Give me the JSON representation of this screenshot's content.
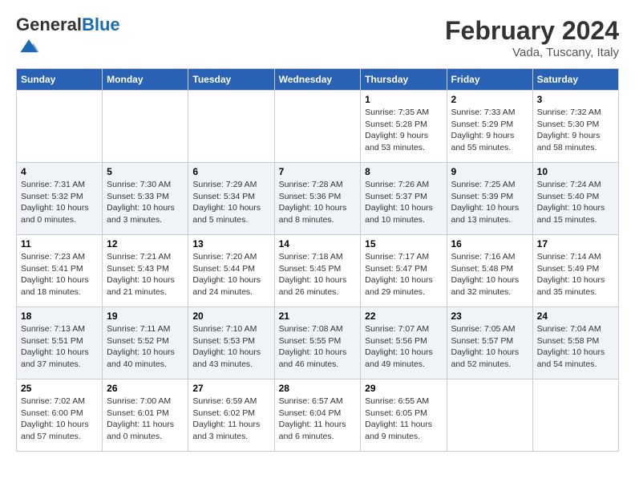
{
  "header": {
    "logo_general": "General",
    "logo_blue": "Blue",
    "month_year": "February 2024",
    "location": "Vada, Tuscany, Italy"
  },
  "days_of_week": [
    "Sunday",
    "Monday",
    "Tuesday",
    "Wednesday",
    "Thursday",
    "Friday",
    "Saturday"
  ],
  "weeks": [
    [
      {
        "day": "",
        "info": ""
      },
      {
        "day": "",
        "info": ""
      },
      {
        "day": "",
        "info": ""
      },
      {
        "day": "",
        "info": ""
      },
      {
        "day": "1",
        "info": "Sunrise: 7:35 AM\nSunset: 5:28 PM\nDaylight: 9 hours\nand 53 minutes."
      },
      {
        "day": "2",
        "info": "Sunrise: 7:33 AM\nSunset: 5:29 PM\nDaylight: 9 hours\nand 55 minutes."
      },
      {
        "day": "3",
        "info": "Sunrise: 7:32 AM\nSunset: 5:30 PM\nDaylight: 9 hours\nand 58 minutes."
      }
    ],
    [
      {
        "day": "4",
        "info": "Sunrise: 7:31 AM\nSunset: 5:32 PM\nDaylight: 10 hours\nand 0 minutes."
      },
      {
        "day": "5",
        "info": "Sunrise: 7:30 AM\nSunset: 5:33 PM\nDaylight: 10 hours\nand 3 minutes."
      },
      {
        "day": "6",
        "info": "Sunrise: 7:29 AM\nSunset: 5:34 PM\nDaylight: 10 hours\nand 5 minutes."
      },
      {
        "day": "7",
        "info": "Sunrise: 7:28 AM\nSunset: 5:36 PM\nDaylight: 10 hours\nand 8 minutes."
      },
      {
        "day": "8",
        "info": "Sunrise: 7:26 AM\nSunset: 5:37 PM\nDaylight: 10 hours\nand 10 minutes."
      },
      {
        "day": "9",
        "info": "Sunrise: 7:25 AM\nSunset: 5:39 PM\nDaylight: 10 hours\nand 13 minutes."
      },
      {
        "day": "10",
        "info": "Sunrise: 7:24 AM\nSunset: 5:40 PM\nDaylight: 10 hours\nand 15 minutes."
      }
    ],
    [
      {
        "day": "11",
        "info": "Sunrise: 7:23 AM\nSunset: 5:41 PM\nDaylight: 10 hours\nand 18 minutes."
      },
      {
        "day": "12",
        "info": "Sunrise: 7:21 AM\nSunset: 5:43 PM\nDaylight: 10 hours\nand 21 minutes."
      },
      {
        "day": "13",
        "info": "Sunrise: 7:20 AM\nSunset: 5:44 PM\nDaylight: 10 hours\nand 24 minutes."
      },
      {
        "day": "14",
        "info": "Sunrise: 7:18 AM\nSunset: 5:45 PM\nDaylight: 10 hours\nand 26 minutes."
      },
      {
        "day": "15",
        "info": "Sunrise: 7:17 AM\nSunset: 5:47 PM\nDaylight: 10 hours\nand 29 minutes."
      },
      {
        "day": "16",
        "info": "Sunrise: 7:16 AM\nSunset: 5:48 PM\nDaylight: 10 hours\nand 32 minutes."
      },
      {
        "day": "17",
        "info": "Sunrise: 7:14 AM\nSunset: 5:49 PM\nDaylight: 10 hours\nand 35 minutes."
      }
    ],
    [
      {
        "day": "18",
        "info": "Sunrise: 7:13 AM\nSunset: 5:51 PM\nDaylight: 10 hours\nand 37 minutes."
      },
      {
        "day": "19",
        "info": "Sunrise: 7:11 AM\nSunset: 5:52 PM\nDaylight: 10 hours\nand 40 minutes."
      },
      {
        "day": "20",
        "info": "Sunrise: 7:10 AM\nSunset: 5:53 PM\nDaylight: 10 hours\nand 43 minutes."
      },
      {
        "day": "21",
        "info": "Sunrise: 7:08 AM\nSunset: 5:55 PM\nDaylight: 10 hours\nand 46 minutes."
      },
      {
        "day": "22",
        "info": "Sunrise: 7:07 AM\nSunset: 5:56 PM\nDaylight: 10 hours\nand 49 minutes."
      },
      {
        "day": "23",
        "info": "Sunrise: 7:05 AM\nSunset: 5:57 PM\nDaylight: 10 hours\nand 52 minutes."
      },
      {
        "day": "24",
        "info": "Sunrise: 7:04 AM\nSunset: 5:58 PM\nDaylight: 10 hours\nand 54 minutes."
      }
    ],
    [
      {
        "day": "25",
        "info": "Sunrise: 7:02 AM\nSunset: 6:00 PM\nDaylight: 10 hours\nand 57 minutes."
      },
      {
        "day": "26",
        "info": "Sunrise: 7:00 AM\nSunset: 6:01 PM\nDaylight: 11 hours\nand 0 minutes."
      },
      {
        "day": "27",
        "info": "Sunrise: 6:59 AM\nSunset: 6:02 PM\nDaylight: 11 hours\nand 3 minutes."
      },
      {
        "day": "28",
        "info": "Sunrise: 6:57 AM\nSunset: 6:04 PM\nDaylight: 11 hours\nand 6 minutes."
      },
      {
        "day": "29",
        "info": "Sunrise: 6:55 AM\nSunset: 6:05 PM\nDaylight: 11 hours\nand 9 minutes."
      },
      {
        "day": "",
        "info": ""
      },
      {
        "day": "",
        "info": ""
      }
    ]
  ]
}
